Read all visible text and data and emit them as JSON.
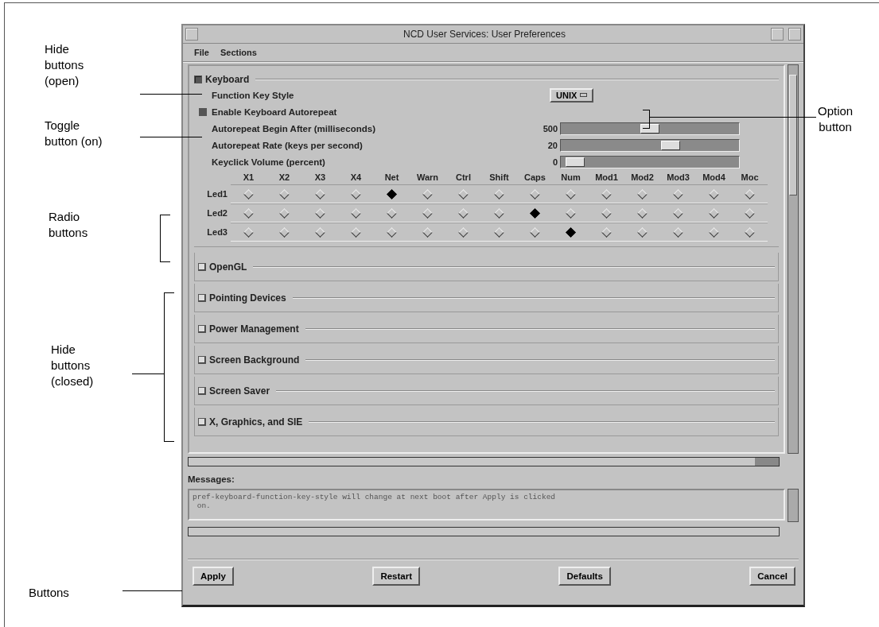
{
  "window": {
    "title": "NCD User Services:  User Preferences"
  },
  "menu": [
    "File",
    "Sections"
  ],
  "sections": [
    {
      "title": "Keyboard",
      "expanded": true,
      "content": {
        "option": {
          "label": "Function Key Style",
          "value": "UNIX"
        },
        "toggle": {
          "label": "Enable Keyboard Autorepeat",
          "on": true
        },
        "sliders": [
          {
            "label": "Autorepeat Begin After  (milliseconds)",
            "reading": "500",
            "level": 0.5
          },
          {
            "label": "Autorepeat Rate  (keys per second)",
            "reading": "20",
            "level": 0.63
          },
          {
            "label": "Keyclick Volume  (percent)",
            "reading": "0",
            "level": 0.03
          }
        ],
        "led_columns": [
          "X1",
          "X2",
          "X3",
          "X4",
          "Net",
          "Warn",
          "Ctrl",
          "Shift",
          "Caps",
          "Num",
          "Mod1",
          "Mod2",
          "Mod3",
          "Mod4",
          "Moc"
        ],
        "led_rows": [
          {
            "label": "Led1",
            "options": [
              {
                "selected": false
              },
              {
                "selected": false
              },
              {
                "selected": false
              },
              {
                "selected": false
              },
              {
                "selected": true
              },
              {
                "selected": false
              },
              {
                "selected": false
              },
              {
                "selected": false
              },
              {
                "selected": false
              },
              {
                "selected": false
              },
              {
                "selected": false
              },
              {
                "selected": false
              },
              {
                "selected": false
              },
              {
                "selected": false
              },
              {
                "selected": false
              }
            ]
          },
          {
            "label": "Led2",
            "options": [
              {
                "selected": false
              },
              {
                "selected": false
              },
              {
                "selected": false
              },
              {
                "selected": false
              },
              {
                "selected": false
              },
              {
                "selected": false
              },
              {
                "selected": false
              },
              {
                "selected": false
              },
              {
                "selected": true
              },
              {
                "selected": false
              },
              {
                "selected": false
              },
              {
                "selected": false
              },
              {
                "selected": false
              },
              {
                "selected": false
              },
              {
                "selected": false
              }
            ]
          },
          {
            "label": "Led3",
            "options": [
              {
                "selected": false
              },
              {
                "selected": false
              },
              {
                "selected": false
              },
              {
                "selected": false
              },
              {
                "selected": false
              },
              {
                "selected": false
              },
              {
                "selected": false
              },
              {
                "selected": false
              },
              {
                "selected": false
              },
              {
                "selected": true
              },
              {
                "selected": false
              },
              {
                "selected": false
              },
              {
                "selected": false
              },
              {
                "selected": false
              },
              {
                "selected": false
              }
            ]
          }
        ]
      }
    },
    {
      "title": "OpenGL",
      "expanded": false
    },
    {
      "title": "Pointing Devices",
      "expanded": false
    },
    {
      "title": "Power Management",
      "expanded": false
    },
    {
      "title": "Screen Background",
      "expanded": false
    },
    {
      "title": "Screen Saver",
      "expanded": false
    },
    {
      "title": "X, Graphics, and SIE",
      "expanded": false
    }
  ],
  "messages": {
    "label": "Messages:",
    "lines": [
      "pref-keyboard-function-key-style will change at next boot after Apply is clicked",
      " on."
    ]
  },
  "buttons": [
    "Apply",
    "Restart",
    "Defaults",
    "Cancel"
  ],
  "callouts": [
    {
      "kind": "left",
      "text": [
        "Hide",
        "buttons",
        "(open)"
      ]
    },
    {
      "kind": "left",
      "text": [
        "Toggle",
        "button (on)"
      ]
    },
    {
      "kind": "left",
      "text": [
        "Radio",
        "buttons"
      ]
    },
    {
      "kind": "left",
      "text": [
        "Hide",
        "buttons",
        "(closed)"
      ]
    },
    {
      "kind": "left",
      "text": [
        "Buttons"
      ]
    },
    {
      "kind": "right",
      "text": [
        "Option",
        "button"
      ]
    }
  ]
}
